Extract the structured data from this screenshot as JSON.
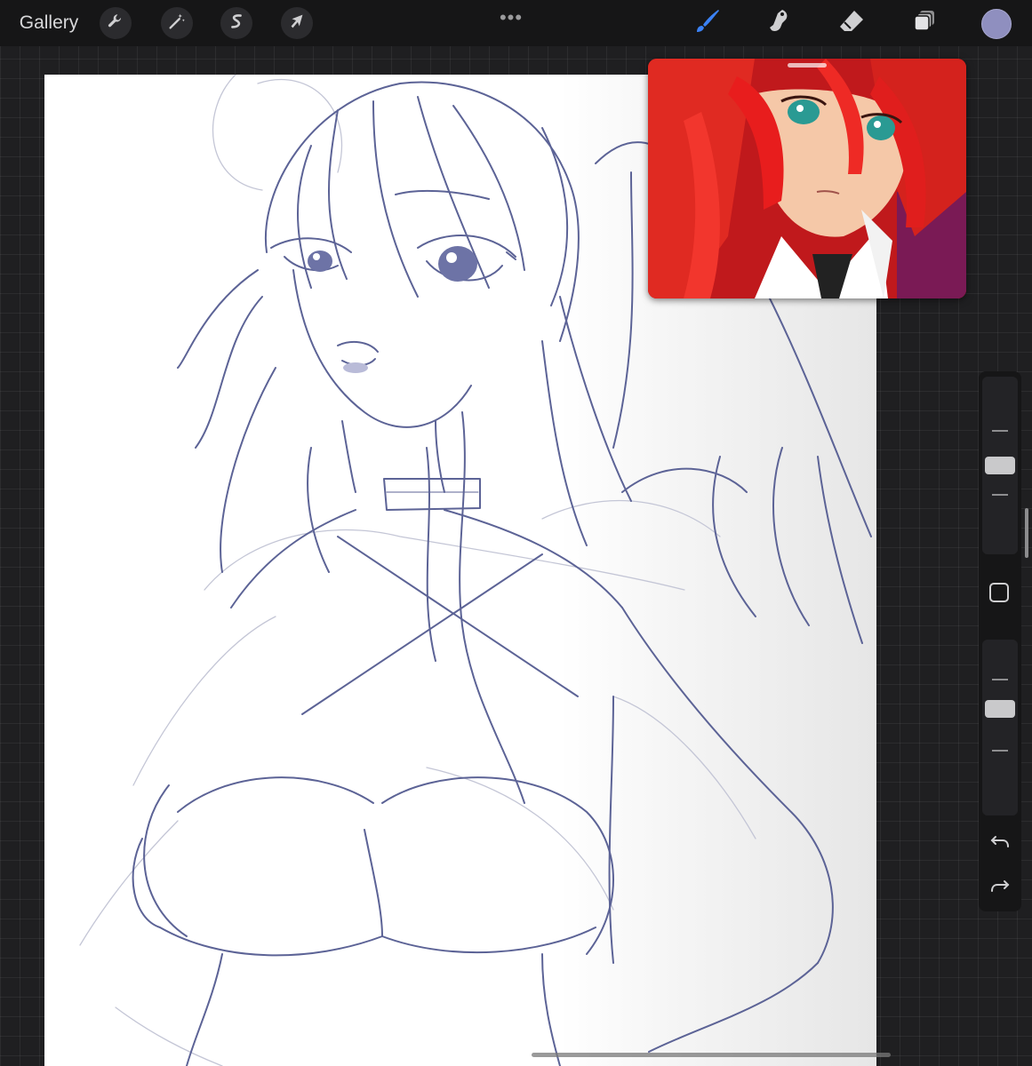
{
  "toolbar": {
    "gallery_label": "Gallery",
    "actions": [
      {
        "name": "actions-icon",
        "icon": "wrench"
      },
      {
        "name": "adjustments-icon",
        "icon": "magic-wand"
      },
      {
        "name": "selection-icon",
        "icon": "s-curve"
      },
      {
        "name": "transform-icon",
        "icon": "arrow-cursor"
      }
    ],
    "more_label": "•••",
    "tools": [
      {
        "name": "brush-icon",
        "active": true
      },
      {
        "name": "smudge-icon",
        "active": false
      },
      {
        "name": "eraser-icon",
        "active": false
      },
      {
        "name": "layers-icon",
        "active": false
      }
    ],
    "active_color": "#8f8fbf",
    "accent_color": "#3b82f6"
  },
  "sidebar": {
    "brush_size_level": 0.5,
    "opacity_level": 0.62,
    "undo_icon": "undo-arrow-icon",
    "redo_icon": "redo-arrow-icon"
  },
  "reference_window": {
    "visible": true
  }
}
